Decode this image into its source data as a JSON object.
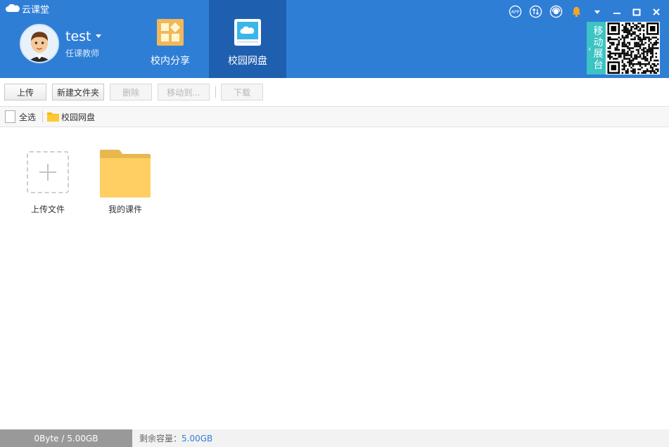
{
  "app": {
    "title": "云课堂"
  },
  "user": {
    "name": "test",
    "role": "任课教师"
  },
  "nav": {
    "tabs": [
      {
        "label": "校内分享",
        "active": false
      },
      {
        "label": "校园网盘",
        "active": true
      }
    ]
  },
  "top_icons": [
    "app-icon",
    "sync-icon",
    "support-icon",
    "bell-icon",
    "dropdown-icon"
  ],
  "window_controls": [
    "minimize",
    "maximize",
    "close"
  ],
  "mobile": {
    "label": "移动展台"
  },
  "toolbar": {
    "upload": "上传",
    "new_folder": "新建文件夹",
    "delete": "删除",
    "move_to": "移动到...",
    "download": "下载"
  },
  "pathbar": {
    "select_all": "全选",
    "crumb": "校园网盘"
  },
  "content": {
    "upload_label": "上传文件",
    "folder_label": "我的课件"
  },
  "status": {
    "used": "0Byte / 5.00GB",
    "remaining_label": "剩余容量：",
    "remaining_value": "5.00GB"
  },
  "colors": {
    "header": "#2f7ed6",
    "active_tab": "#1f5fb0",
    "mobile_tab": "#3cc3c3",
    "folder": "#ffcf64",
    "bell": "#f5a623"
  }
}
